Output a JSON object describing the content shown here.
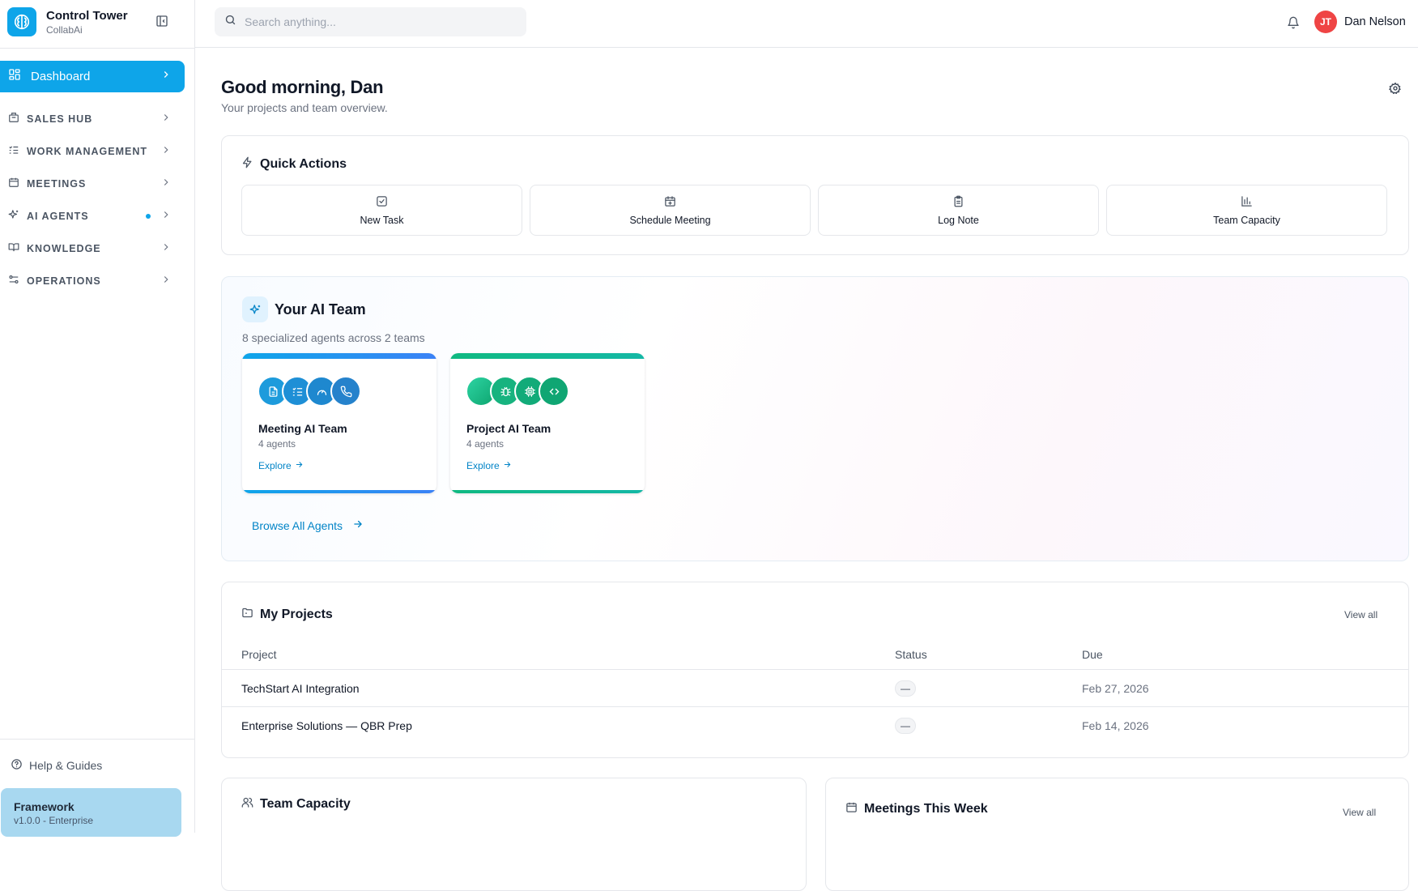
{
  "brand": {
    "title": "Control Tower",
    "subtitle": "CollabAi"
  },
  "sidebar": {
    "dashboard": "Dashboard",
    "items": [
      {
        "label": "SALES HUB",
        "icon": "building-icon"
      },
      {
        "label": "WORK MANAGEMENT",
        "icon": "checklist-icon"
      },
      {
        "label": "MEETINGS",
        "icon": "calendar-icon"
      },
      {
        "label": "AI AGENTS",
        "icon": "sparkles-icon",
        "dot": true
      },
      {
        "label": "KNOWLEDGE",
        "icon": "book-icon"
      },
      {
        "label": "OPERATIONS",
        "icon": "sliders-icon"
      }
    ],
    "help": "Help & Guides",
    "framework": {
      "title": "Framework",
      "version": "v1.0.0 - Enterprise"
    }
  },
  "topbar": {
    "search_placeholder": "Search anything...",
    "user": {
      "initials": "JT",
      "name": "Dan Nelson"
    }
  },
  "main": {
    "greeting": "Good morning, Dan",
    "subtitle": "Your projects and team overview.",
    "quick_actions": {
      "title": "Quick Actions",
      "buttons": [
        "New Task",
        "Schedule Meeting",
        "Log Note",
        "Team Capacity"
      ]
    },
    "ai_team": {
      "title": "Your AI Team",
      "subtitle": "8 specialized agents across 2 teams",
      "teams": [
        {
          "name": "Meeting AI Team",
          "count": "4 agents",
          "explore": "Explore",
          "accent": "#0ea5e9"
        },
        {
          "name": "Project AI Team",
          "count": "4 agents",
          "explore": "Explore",
          "accent": "#10b981"
        }
      ],
      "browse": "Browse All Agents"
    },
    "projects": {
      "title": "My Projects",
      "view_all": "View all",
      "columns": [
        "Project",
        "Status",
        "Due"
      ],
      "rows": [
        {
          "project": "TechStart AI Integration",
          "status": "—",
          "due": "Feb 27, 2026"
        },
        {
          "project": "Enterprise Solutions — QBR Prep",
          "status": "—",
          "due": "Feb 14, 2026"
        }
      ]
    },
    "team_capacity": {
      "title": "Team Capacity"
    },
    "meetings": {
      "title": "Meetings This Week",
      "view_all": "View all"
    }
  },
  "colors": {
    "accent": "#0ea5e9",
    "teal": "#10b981",
    "avatar": "#ef4444"
  }
}
